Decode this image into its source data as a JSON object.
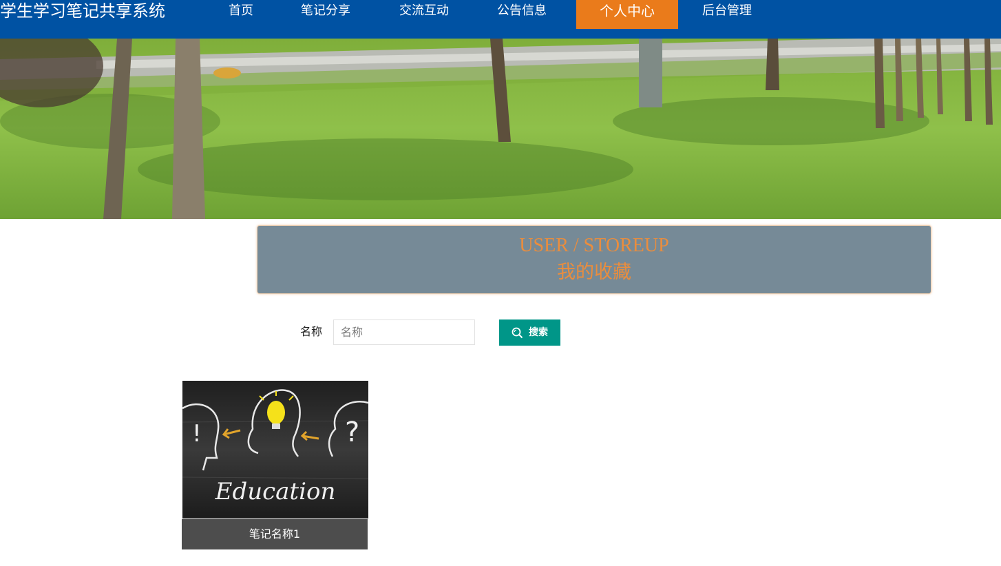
{
  "header": {
    "site_title": "学生学习笔记共享系统",
    "nav": [
      {
        "label": "首页",
        "active": false
      },
      {
        "label": "笔记分享",
        "active": false
      },
      {
        "label": "交流互动",
        "active": false
      },
      {
        "label": "公告信息",
        "active": false
      },
      {
        "label": "个人中心",
        "active": true
      },
      {
        "label": "后台管理",
        "active": false
      }
    ],
    "colors": {
      "bar": "#0052a3",
      "active": "#ea7b1b"
    }
  },
  "banner": {
    "slides": 3,
    "active_slide": 2
  },
  "page_title": {
    "en": "USER / STOREUP",
    "cn": "我的收藏"
  },
  "search": {
    "label": "名称",
    "placeholder": "名称",
    "value": "",
    "button_label": "搜索",
    "button_icon": "search-icon",
    "button_color": "#009688"
  },
  "favorites": [
    {
      "image_text": "Education",
      "title": "笔记名称1"
    }
  ]
}
